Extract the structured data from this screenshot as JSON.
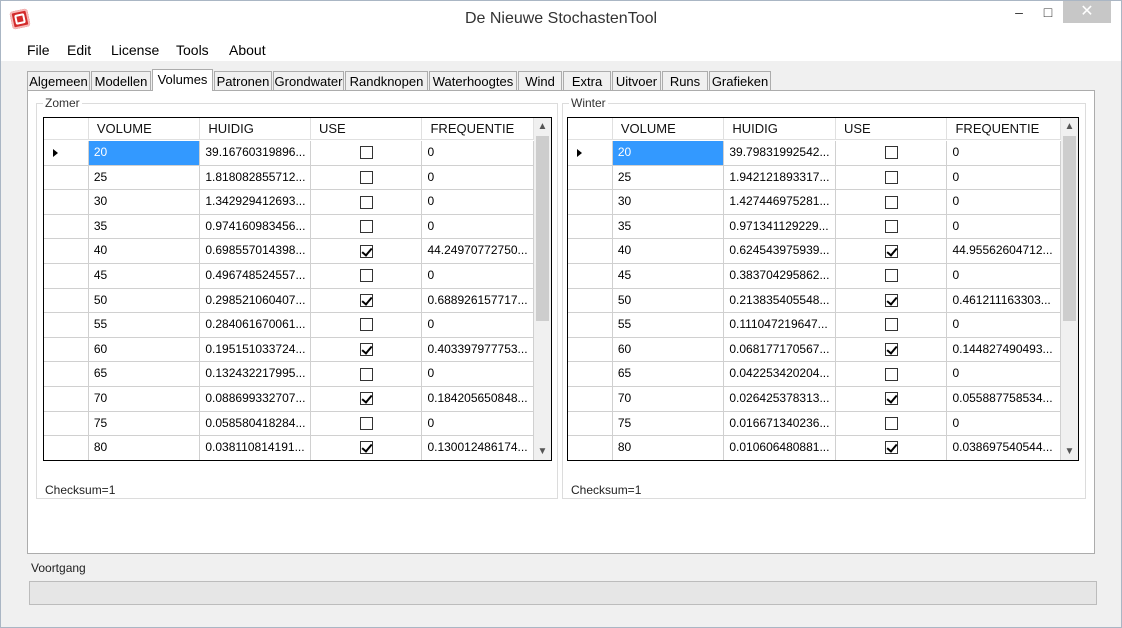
{
  "window": {
    "title": "De Nieuwe StochastenTool",
    "min_glyph": "–",
    "max_glyph": "□",
    "close_glyph": "✕"
  },
  "menu": [
    "File",
    "Edit",
    "License",
    "Tools",
    "About"
  ],
  "tabs": [
    "Algemeen",
    "Modellen",
    "Volumes",
    "Patronen",
    "Grondwater",
    "Randknopen",
    "Waterhoogtes",
    "Wind",
    "Extra",
    "Uitvoer",
    "Runs",
    "Grafieken"
  ],
  "active_tab": "Volumes",
  "columns": [
    "VOLUME",
    "HUIDIG",
    "USE",
    "FREQUENTIE"
  ],
  "zomer": {
    "label": "Zomer",
    "checksum": "Checksum=1",
    "rows": [
      {
        "volume": "20",
        "huidig": "39.16760319896...",
        "use": false,
        "freq": "0"
      },
      {
        "volume": "25",
        "huidig": "1.818082855712...",
        "use": false,
        "freq": "0"
      },
      {
        "volume": "30",
        "huidig": "1.342929412693...",
        "use": false,
        "freq": "0"
      },
      {
        "volume": "35",
        "huidig": "0.974160983456...",
        "use": false,
        "freq": "0"
      },
      {
        "volume": "40",
        "huidig": "0.698557014398...",
        "use": true,
        "freq": "44.24970772750..."
      },
      {
        "volume": "45",
        "huidig": "0.496748524557...",
        "use": false,
        "freq": "0"
      },
      {
        "volume": "50",
        "huidig": "0.298521060407...",
        "use": true,
        "freq": "0.688926157717..."
      },
      {
        "volume": "55",
        "huidig": "0.284061670061...",
        "use": false,
        "freq": "0"
      },
      {
        "volume": "60",
        "huidig": "0.195151033724...",
        "use": true,
        "freq": "0.403397977753..."
      },
      {
        "volume": "65",
        "huidig": "0.132432217995...",
        "use": false,
        "freq": "0"
      },
      {
        "volume": "70",
        "huidig": "0.088699332707...",
        "use": true,
        "freq": "0.184205650848..."
      },
      {
        "volume": "75",
        "huidig": "0.058580418284...",
        "use": false,
        "freq": "0"
      },
      {
        "volume": "80",
        "huidig": "0.038110814191...",
        "use": true,
        "freq": "0.130012486174..."
      }
    ]
  },
  "winter": {
    "label": "Winter",
    "checksum": "Checksum=1",
    "rows": [
      {
        "volume": "20",
        "huidig": "39.79831992542...",
        "use": false,
        "freq": "0"
      },
      {
        "volume": "25",
        "huidig": "1.942121893317...",
        "use": false,
        "freq": "0"
      },
      {
        "volume": "30",
        "huidig": "1.427446975281...",
        "use": false,
        "freq": "0"
      },
      {
        "volume": "35",
        "huidig": "0.971341129229...",
        "use": false,
        "freq": "0"
      },
      {
        "volume": "40",
        "huidig": "0.624543975939...",
        "use": true,
        "freq": "44.95562604712..."
      },
      {
        "volume": "45",
        "huidig": "0.383704295862...",
        "use": false,
        "freq": "0"
      },
      {
        "volume": "50",
        "huidig": "0.213835405548...",
        "use": true,
        "freq": "0.461211163303..."
      },
      {
        "volume": "55",
        "huidig": "0.111047219647...",
        "use": false,
        "freq": "0"
      },
      {
        "volume": "60",
        "huidig": "0.068177170567...",
        "use": true,
        "freq": "0.144827490493..."
      },
      {
        "volume": "65",
        "huidig": "0.042253420204...",
        "use": false,
        "freq": "0"
      },
      {
        "volume": "70",
        "huidig": "0.026425378313...",
        "use": true,
        "freq": "0.055887758534..."
      },
      {
        "volume": "75",
        "huidig": "0.016671340236...",
        "use": false,
        "freq": "0"
      },
      {
        "volume": "80",
        "huidig": "0.010606480881...",
        "use": true,
        "freq": "0.038697540544..."
      }
    ]
  },
  "progress": {
    "label": "Voortgang",
    "value": 0
  }
}
